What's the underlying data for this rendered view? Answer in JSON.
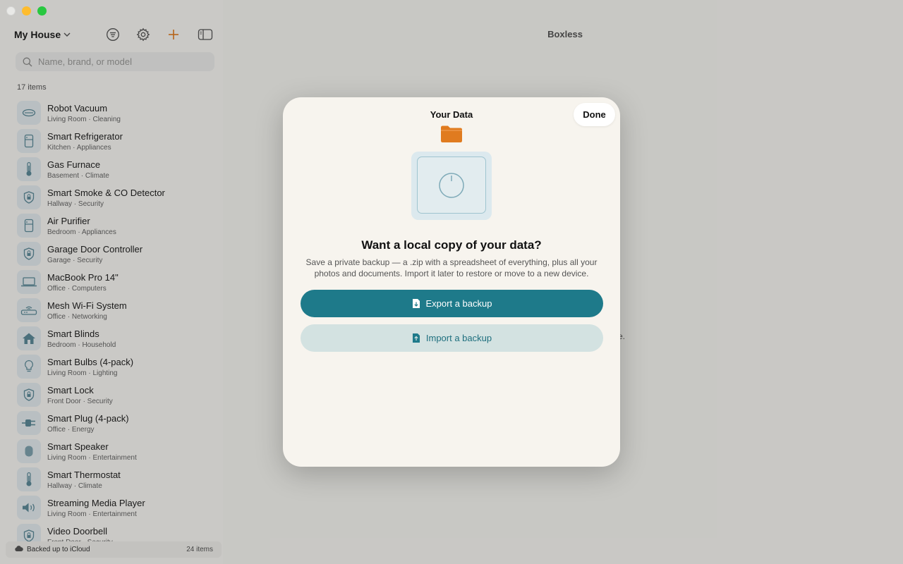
{
  "window": {
    "title": "Boxless"
  },
  "sidebar": {
    "house_name": "My House",
    "search_placeholder": "Name, brand, or model",
    "count": "17 items",
    "items": [
      {
        "name": "Robot Vacuum",
        "sub": "Living Room · Cleaning",
        "icon": "robot-vacuum-icon"
      },
      {
        "name": "Smart Refrigerator",
        "sub": "Kitchen · Appliances",
        "icon": "refrigerator-icon"
      },
      {
        "name": "Gas Furnace",
        "sub": "Basement · Climate",
        "icon": "thermometer-icon"
      },
      {
        "name": "Smart Smoke & CO Detector",
        "sub": "Hallway · Security",
        "icon": "shield-icon"
      },
      {
        "name": "Air Purifier",
        "sub": "Bedroom · Appliances",
        "icon": "refrigerator-icon"
      },
      {
        "name": "Garage Door Controller",
        "sub": "Garage · Security",
        "icon": "shield-icon"
      },
      {
        "name": "MacBook Pro 14\"",
        "sub": "Office · Computers",
        "icon": "laptop-icon"
      },
      {
        "name": "Mesh Wi-Fi System",
        "sub": "Office · Networking",
        "icon": "router-icon"
      },
      {
        "name": "Smart Blinds",
        "sub": "Bedroom · Household",
        "icon": "house-icon"
      },
      {
        "name": "Smart Bulbs (4-pack)",
        "sub": "Living Room · Lighting",
        "icon": "lightbulb-icon"
      },
      {
        "name": "Smart Lock",
        "sub": "Front Door · Security",
        "icon": "shield-icon"
      },
      {
        "name": "Smart Plug (4-pack)",
        "sub": "Office · Energy",
        "icon": "plug-icon"
      },
      {
        "name": "Smart Speaker",
        "sub": "Living Room · Entertainment",
        "icon": "speaker-icon"
      },
      {
        "name": "Smart Thermostat",
        "sub": "Hallway · Climate",
        "icon": "thermometer-icon"
      },
      {
        "name": "Streaming Media Player",
        "sub": "Living Room · Entertainment",
        "icon": "speaker-wave-icon"
      },
      {
        "name": "Video Doorbell",
        "sub": "Front Door · Security",
        "icon": "shield-icon"
      }
    ],
    "footer_left": "Backed up to iCloud",
    "footer_right": "24 items"
  },
  "main": {
    "hint_fragment": "se."
  },
  "modal": {
    "title": "Your Data",
    "done_label": "Done",
    "heading": "Want a local copy of your data?",
    "body": "Save a private backup — a .zip with a spreadsheet of everything, plus all your photos and documents. Import it later to restore or move to a new device.",
    "export_label": "Export a backup",
    "import_label": "Import a backup",
    "colors": {
      "accent": "#1e7a8a",
      "folder": "#e07b1f",
      "secondary": "#d3e2e1"
    }
  }
}
